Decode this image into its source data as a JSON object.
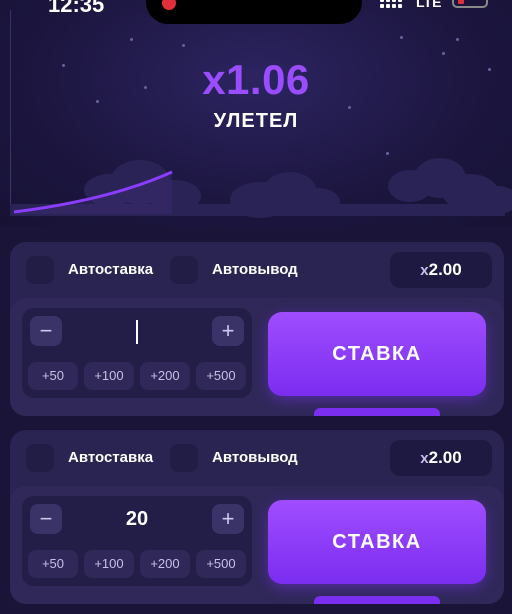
{
  "status_bar": {
    "time": "12:35",
    "network": "LTE"
  },
  "game": {
    "multiplier": "x1.06",
    "status": "УЛЕТЕЛ"
  },
  "bet_panels": [
    {
      "auto_bet_label": "Автоставка",
      "auto_cashout_label": "Автовывод",
      "auto_cashout_value": "2.00",
      "auto_cashout_prefix": "x",
      "amount": "",
      "minus_label": "−",
      "plus_label": "+",
      "quick_amounts": [
        "+50",
        "+100",
        "+200",
        "+500"
      ],
      "bet_button_label": "СТАВКА"
    },
    {
      "auto_bet_label": "Автоставка",
      "auto_cashout_label": "Автовывод",
      "auto_cashout_value": "2.00",
      "auto_cashout_prefix": "x",
      "amount": "20",
      "minus_label": "−",
      "plus_label": "+",
      "quick_amounts": [
        "+50",
        "+100",
        "+200",
        "+500"
      ],
      "bet_button_label": "СТАВКА"
    }
  ],
  "colors": {
    "accent": "#9a4dff",
    "background": "#1a1538",
    "panel": "#2a2452"
  }
}
